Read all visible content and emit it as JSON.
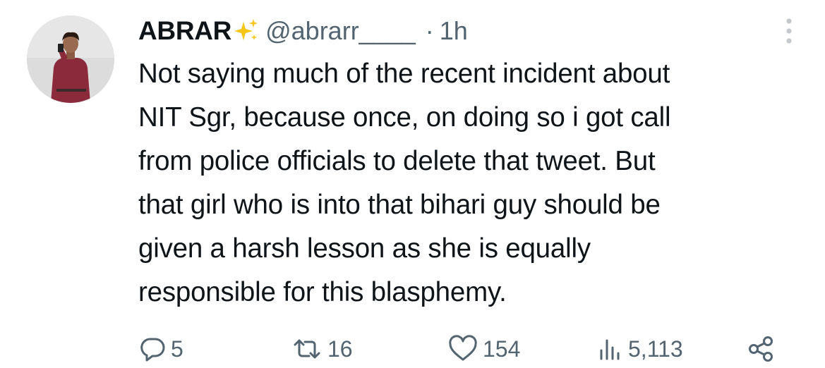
{
  "author": {
    "display_name": "ABRAR",
    "badge_icon": "sparkles-icon",
    "handle": "@abrarr____",
    "separator": "·",
    "time": "1h"
  },
  "tweet": {
    "text": "Not saying much of the recent incident about\nNIT Sgr, because once, on doing so i got call\nfrom police officials to delete that tweet. But\nthat girl who is into that bihari guy should be\ngiven a harsh lesson as she is equally\nresponsible for this blasphemy."
  },
  "actions": {
    "replies": "5",
    "reposts": "16",
    "likes": "154",
    "views": "5,113"
  },
  "colors": {
    "text": "#0f1419",
    "muted": "#536471",
    "sparkle": "#f5c518",
    "background": "#ffffff"
  }
}
